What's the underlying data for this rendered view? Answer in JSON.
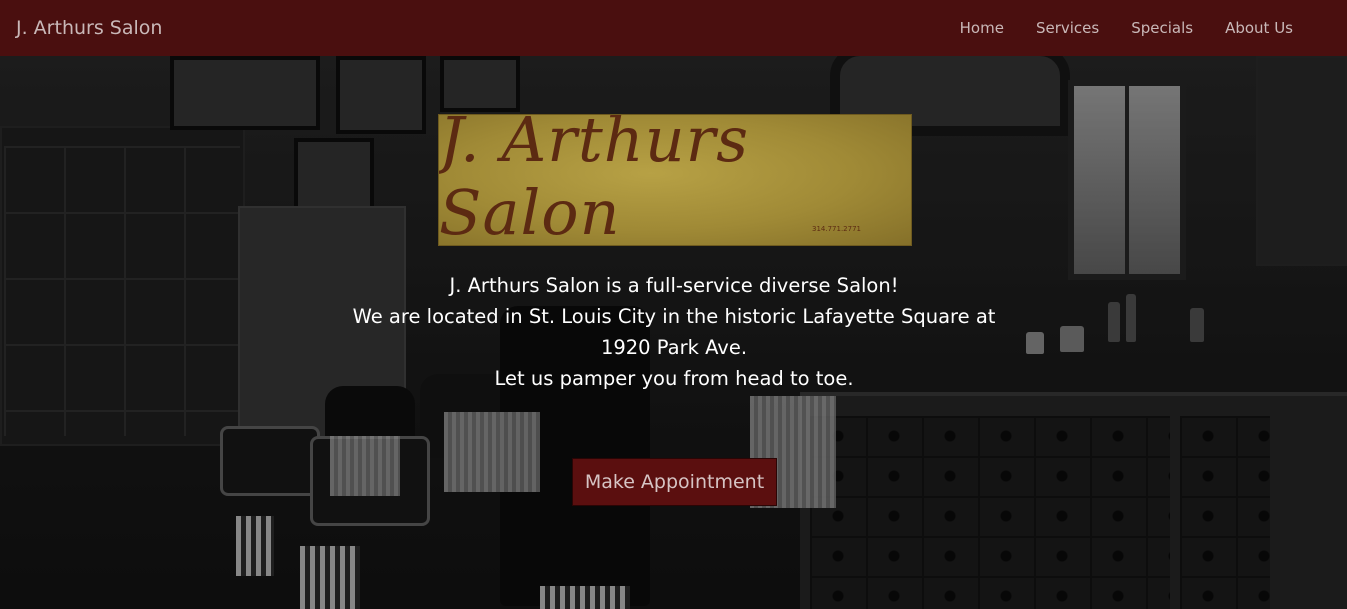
{
  "navbar": {
    "brand": "J. Arthurs Salon",
    "links": [
      "Home",
      "Services",
      "Specials",
      "About Us"
    ]
  },
  "hero": {
    "logo_text": "J. Arthurs Salon",
    "logo_phone": "314.771.2771",
    "intro_lines": [
      "J. Arthurs Salon is a full-service diverse Salon!",
      "We are located in St. Louis City in the historic Lafayette Square at 1920 Park Ave.",
      "Let us pamper you from head to toe."
    ],
    "appointment_button": "Make Appointment"
  },
  "colors": {
    "navbar_bg": "#4a0f0f",
    "button_bg": "#5b0f0f",
    "logo_gold": "#a08a36",
    "logo_ink": "#5c2a12"
  }
}
